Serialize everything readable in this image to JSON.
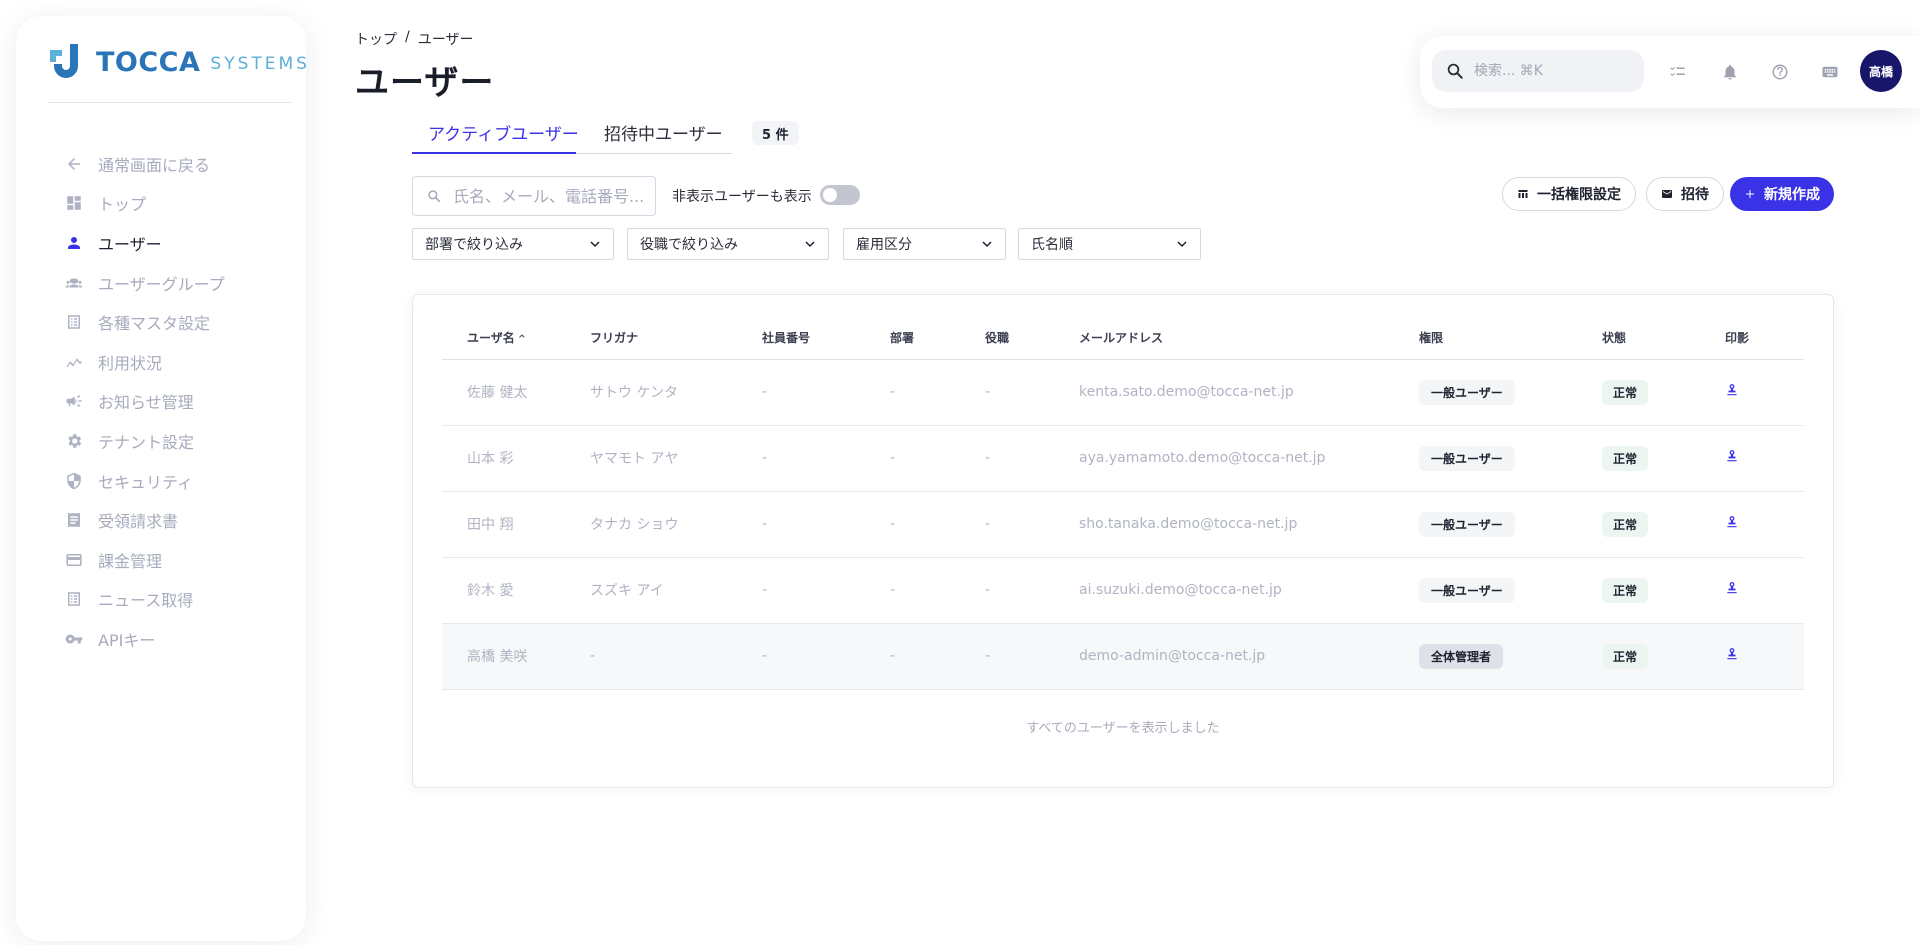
{
  "brand": {
    "name": "TOCCA",
    "sub": "SYSTEMS"
  },
  "sidebar": {
    "items": [
      {
        "label": "通常画面に戻る",
        "icon": "arrow-left-icon"
      },
      {
        "label": "トップ",
        "icon": "dashboard-icon"
      },
      {
        "label": "ユーザー",
        "icon": "user-icon",
        "active": true
      },
      {
        "label": "ユーザーグループ",
        "icon": "group-icon"
      },
      {
        "label": "各種マスタ設定",
        "icon": "list-icon"
      },
      {
        "label": "利用状況",
        "icon": "chart-icon"
      },
      {
        "label": "お知らせ管理",
        "icon": "megaphone-icon"
      },
      {
        "label": "テナント設定",
        "icon": "gear-icon"
      },
      {
        "label": "セキュリティ",
        "icon": "shield-icon"
      },
      {
        "label": "受領請求書",
        "icon": "document-icon"
      },
      {
        "label": "課金管理",
        "icon": "credit-card-icon"
      },
      {
        "label": "ニュース取得",
        "icon": "news-icon"
      },
      {
        "label": "APIキー",
        "icon": "key-icon"
      }
    ]
  },
  "breadcrumb": {
    "home": "トップ",
    "separator": "/",
    "current": "ユーザー"
  },
  "page": {
    "title": "ユーザー"
  },
  "topbar": {
    "search_placeholder": "検索... ⌘K",
    "avatar_label": "高橋"
  },
  "tabs": {
    "active": "アクティブユーザー",
    "invited": "招待中ユーザー",
    "count": "5 件"
  },
  "filters": {
    "search_placeholder": "氏名、メール、電話番号...",
    "toggle_label": "非表示ユーザーも表示",
    "department": "部署で絞り込み",
    "role": "役職で絞り込み",
    "employment": "雇用区分",
    "sort": "氏名順"
  },
  "actions": {
    "bulk": "一括権限設定",
    "invite": "招待",
    "new": "新規作成"
  },
  "table": {
    "headers": {
      "name": "ユーザ名",
      "kana": "フリガナ",
      "employee_no": "社員番号",
      "department": "部署",
      "position": "役職",
      "email": "メールアドレス",
      "permission": "権限",
      "status": "状態",
      "seal": "印影"
    },
    "rows": [
      {
        "name": "佐藤 健太",
        "kana": "サトウ ケンタ",
        "employee_no": "-",
        "department": "-",
        "position": "-",
        "email": "kenta.sato.demo@tocca-net.jp",
        "permission": "一般ユーザー",
        "status": "正常"
      },
      {
        "name": "山本 彩",
        "kana": "ヤマモト アヤ",
        "employee_no": "-",
        "department": "-",
        "position": "-",
        "email": "aya.yamamoto.demo@tocca-net.jp",
        "permission": "一般ユーザー",
        "status": "正常"
      },
      {
        "name": "田中 翔",
        "kana": "タナカ ショウ",
        "employee_no": "-",
        "department": "-",
        "position": "-",
        "email": "sho.tanaka.demo@tocca-net.jp",
        "permission": "一般ユーザー",
        "status": "正常"
      },
      {
        "name": "鈴木 愛",
        "kana": "スズキ アイ",
        "employee_no": "-",
        "department": "-",
        "position": "-",
        "email": "ai.suzuki.demo@tocca-net.jp",
        "permission": "一般ユーザー",
        "status": "正常"
      },
      {
        "name": "高橋 美咲",
        "kana": "-",
        "employee_no": "-",
        "department": "-",
        "position": "-",
        "email": "demo-admin@tocca-net.jp",
        "permission": "全体管理者",
        "status": "正常"
      }
    ],
    "footer": "すべてのユーザーを表示しました"
  },
  "colors": {
    "accent": "#3a32e6",
    "brand": "#2a75b8",
    "avatar": "#17166b"
  }
}
